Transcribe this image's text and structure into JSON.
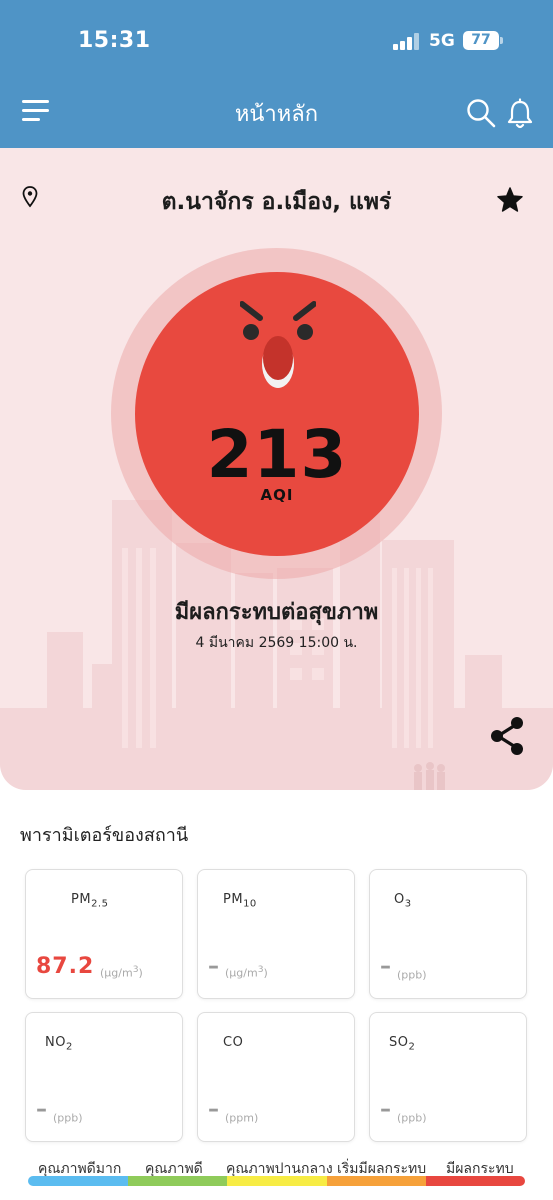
{
  "status_bar": {
    "time": "15:31",
    "network": "5G",
    "battery": "77"
  },
  "header": {
    "title": "หน้าหลัก",
    "menu_icon": "hamburger-menu-icon",
    "search_icon": "search-icon",
    "notification_icon": "bell-icon"
  },
  "station": {
    "location": "ต.นาจักร อ.เมือง, แพร่",
    "pin_icon": "location-pin-icon",
    "favorite_icon": "star-icon"
  },
  "aqi": {
    "value": "213",
    "unit": "AQI",
    "status": "มีผลกระทบต่อสุขภาพ",
    "datetime": "4 มีนาคม 2569  15:00 น.",
    "face_icon": "angry-face-icon",
    "color": "#e8493f"
  },
  "share_icon": "share-icon",
  "parameters": {
    "title": "พารามิเตอร์ของสถานี",
    "items": [
      {
        "name": "PM",
        "sub": "2.5",
        "value": "87.2",
        "unit": "(μg/m",
        "unit_sup": "3",
        "unit_end": ")"
      },
      {
        "name": "PM",
        "sub": "10",
        "value": "–",
        "unit": "(μg/m",
        "unit_sup": "3",
        "unit_end": ")"
      },
      {
        "name": "O",
        "sub": "3",
        "value": "–",
        "unit": "(ppb)",
        "unit_sup": "",
        "unit_end": ""
      },
      {
        "name": "NO",
        "sub": "2",
        "value": "–",
        "unit": "(ppb)",
        "unit_sup": "",
        "unit_end": ""
      },
      {
        "name": "CO",
        "sub": "",
        "value": "–",
        "unit": "(ppm)",
        "unit_sup": "",
        "unit_end": ""
      },
      {
        "name": "SO",
        "sub": "2",
        "value": "–",
        "unit": "(ppb)",
        "unit_sup": "",
        "unit_end": ""
      }
    ]
  },
  "legend": [
    {
      "label": "คุณภาพดีมาก",
      "color": "#5bbcf0"
    },
    {
      "label": "คุณภาพดี",
      "color": "#8fcb5a"
    },
    {
      "label": "คุณภาพปานกลาง",
      "color": "#f7ec44"
    },
    {
      "label": "เริ่มมีผลกระทบ",
      "color": "#f6a13a"
    },
    {
      "label": "มีผลกระทบ",
      "color": "#e8473f"
    }
  ]
}
